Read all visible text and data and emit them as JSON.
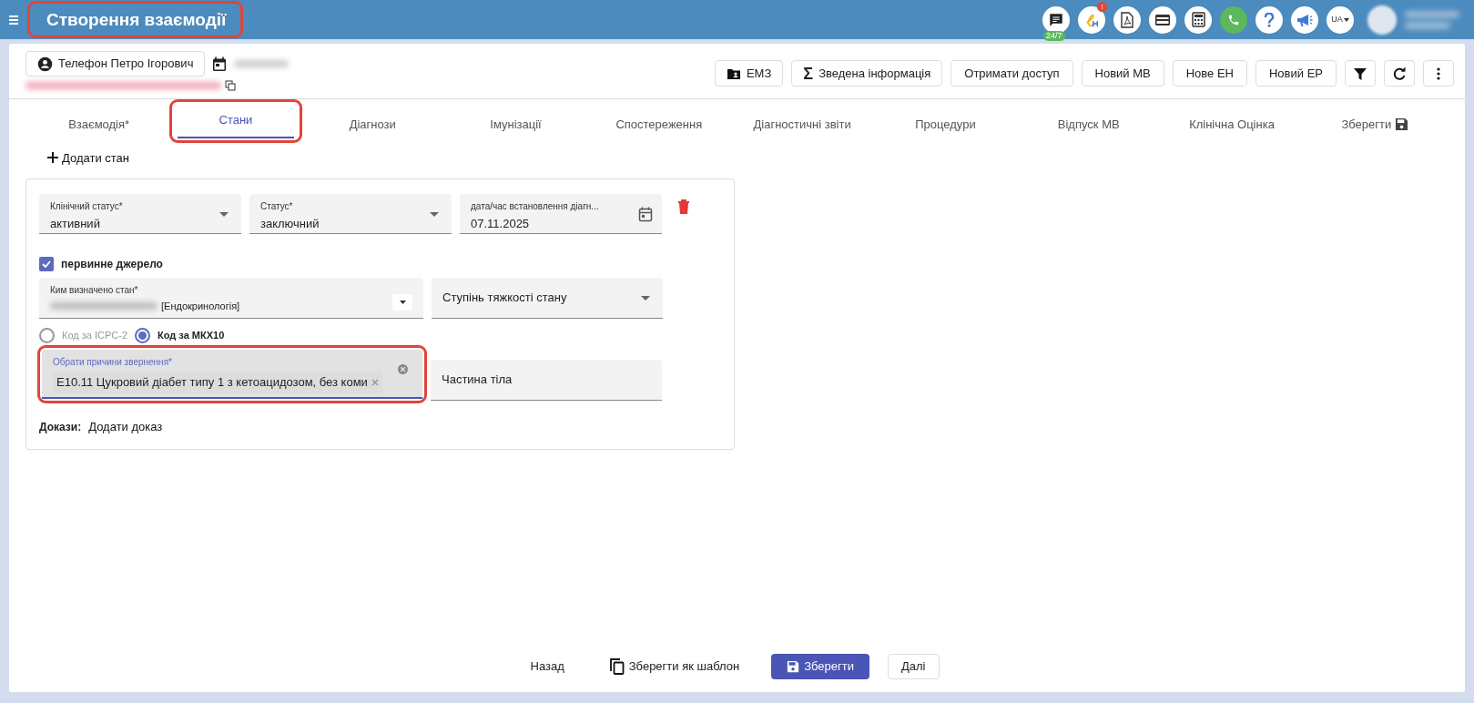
{
  "header": {
    "title": "Створення взаємодії",
    "highlighted": true,
    "chat_badge": "24/7",
    "alert_badge": "!",
    "language": "UA"
  },
  "patient": {
    "name": "Телефон Петро Ігорович"
  },
  "toolbar": [
    {
      "label": "ЕМЗ",
      "kind": "folder"
    },
    {
      "label": "Зведена інформація",
      "kind": "symbol",
      "icon": "Σ"
    },
    {
      "label": "Отримати доступ",
      "kind": "plain"
    },
    {
      "label": "Новий МВ",
      "kind": "plain"
    },
    {
      "label": "Нове ЕН",
      "kind": "plain"
    },
    {
      "label": "Новий ЕР",
      "kind": "plain"
    },
    {
      "kind": "filter"
    },
    {
      "kind": "refresh"
    },
    {
      "kind": "more"
    }
  ],
  "tabs": [
    {
      "label": "Взаємодія*",
      "selected": false,
      "highlighted": false,
      "kind": "text"
    },
    {
      "label": "Стани",
      "selected": true,
      "highlighted": true,
      "kind": "text"
    },
    {
      "label": "Діагнози",
      "selected": false,
      "highlighted": false,
      "kind": "text"
    },
    {
      "label": "Імунізації",
      "selected": false,
      "highlighted": false,
      "kind": "text"
    },
    {
      "label": "Спостереження",
      "selected": false,
      "highlighted": false,
      "kind": "text"
    },
    {
      "label": "Діагностичні звіти",
      "selected": false,
      "highlighted": false,
      "kind": "text"
    },
    {
      "label": "Процедури",
      "selected": false,
      "highlighted": false,
      "kind": "text"
    },
    {
      "label": "Відпуск МВ",
      "selected": false,
      "highlighted": false,
      "kind": "text"
    },
    {
      "label": "Клінічна Оцінка",
      "selected": false,
      "highlighted": false,
      "kind": "text"
    },
    {
      "label": "Зберегти",
      "selected": false,
      "highlighted": false,
      "kind": "save"
    }
  ],
  "add_condition": "Додати стан",
  "condition": {
    "clinical_status": {
      "label": "Клінічний статус*",
      "value": "активний"
    },
    "verification_status": {
      "label": "Статус*",
      "value": "заключний"
    },
    "onset_date": {
      "label": "дата/час встановлення діагн...",
      "value": "07.11.2025"
    },
    "primary_source": {
      "label": "первинне джерело",
      "checked": true
    },
    "asserter": {
      "label": "Ким визначено стан*",
      "value": "[Ендокринологія]"
    },
    "severity": {
      "placeholder": "Ступінь тяжкості стану"
    },
    "code_systems": [
      {
        "label": "Код за ICPC-2",
        "selected": false
      },
      {
        "label": "Код за МКХ10",
        "selected": true
      }
    ],
    "reason": {
      "label": "Обрати причини звернення*",
      "chips": [
        "E10.11 Цукровий діабет типу 1 з кетоацидозом, без коми"
      ],
      "highlighted": true
    },
    "body_site": {
      "placeholder": "Частина тіла"
    },
    "evidence": {
      "label": "Докази:",
      "link": "Додати доказ"
    }
  },
  "footer": [
    {
      "label": "Назад",
      "kind": "text"
    },
    {
      "label": "Зберегти як шаблон",
      "kind": "copy"
    },
    {
      "label": "Зберегти",
      "kind": "primary"
    },
    {
      "label": "Далі",
      "kind": "outline"
    }
  ]
}
